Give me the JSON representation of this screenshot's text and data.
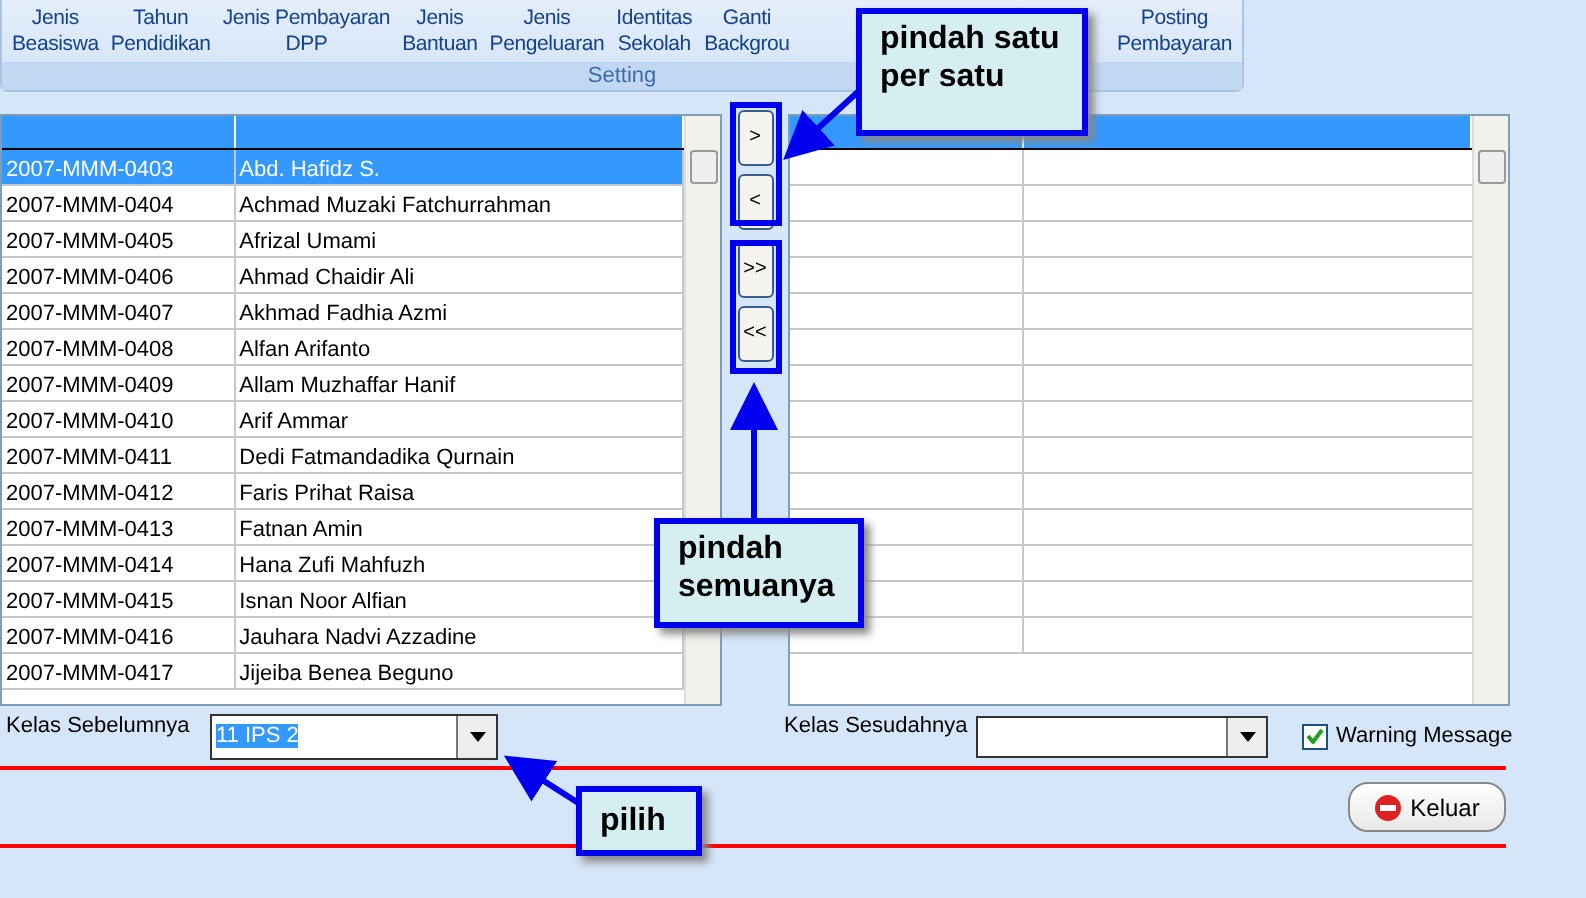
{
  "ribbon": {
    "items": [
      {
        "label": "Jenis\nBeasiswa"
      },
      {
        "label": "Tahun\nPendidikan"
      },
      {
        "label": "Jenis Pembayaran\nDPP"
      },
      {
        "label": "Jenis\nBantuan"
      },
      {
        "label": "Jenis\nPengeluaran"
      },
      {
        "label": "Identitas\nSekolah"
      },
      {
        "label": "Ganti\nBackgrou"
      },
      {
        "label": "Posting\nPembayaran"
      }
    ],
    "group_label": "Setting"
  },
  "left_table": {
    "rows": [
      {
        "selected": true,
        "cells": [
          "2007-MMM-0403",
          "Abd. Hafidz S."
        ]
      },
      {
        "selected": false,
        "cells": [
          "2007-MMM-0404",
          "Achmad Muzaki Fatchurrahman"
        ]
      },
      {
        "selected": false,
        "cells": [
          "2007-MMM-0405",
          "Afrizal Umami"
        ]
      },
      {
        "selected": false,
        "cells": [
          "2007-MMM-0406",
          "Ahmad Chaidir Ali"
        ]
      },
      {
        "selected": false,
        "cells": [
          "2007-MMM-0407",
          "Akhmad Fadhia Azmi"
        ]
      },
      {
        "selected": false,
        "cells": [
          "2007-MMM-0408",
          "Alfan Arifanto"
        ]
      },
      {
        "selected": false,
        "cells": [
          "2007-MMM-0409",
          "Allam Muzhaffar Hanif"
        ]
      },
      {
        "selected": false,
        "cells": [
          "2007-MMM-0410",
          "Arif Ammar"
        ]
      },
      {
        "selected": false,
        "cells": [
          "2007-MMM-0411",
          "Dedi Fatmandadika Qurnain"
        ]
      },
      {
        "selected": false,
        "cells": [
          "2007-MMM-0412",
          "Faris Prihat Raisa"
        ]
      },
      {
        "selected": false,
        "cells": [
          "2007-MMM-0413",
          "Fatnan Amin"
        ]
      },
      {
        "selected": false,
        "cells": [
          "2007-MMM-0414",
          "Hana Zufi Mahfuzh"
        ]
      },
      {
        "selected": false,
        "cells": [
          "2007-MMM-0415",
          "Isnan Noor Alfian"
        ]
      },
      {
        "selected": false,
        "cells": [
          "2007-MMM-0416",
          "Jauhara Nadvi Azzadine"
        ]
      },
      {
        "selected": false,
        "cells": [
          "2007-MMM-0417",
          "Jijeiba Benea Beguno"
        ]
      }
    ]
  },
  "transfer_buttons": [
    {
      "label": ">"
    },
    {
      "label": "<"
    },
    {
      "label": ">>"
    },
    {
      "label": "<<"
    }
  ],
  "kelas_sebelumnya": {
    "label": "Kelas Sebelumnya",
    "value": "11 IPS 2"
  },
  "kelas_sesudahnya": {
    "label": "Kelas Sesudahnya"
  },
  "warning_message": {
    "label": "Warning Message",
    "checked": true
  },
  "keluar_button": {
    "label": "Keluar"
  },
  "callouts": [
    {
      "kind": "single",
      "text": "pindah satu\nper satu"
    },
    {
      "kind": "all",
      "text": "pindah\nsemuanya"
    },
    {
      "kind": "pick",
      "text": "pilih"
    }
  ]
}
